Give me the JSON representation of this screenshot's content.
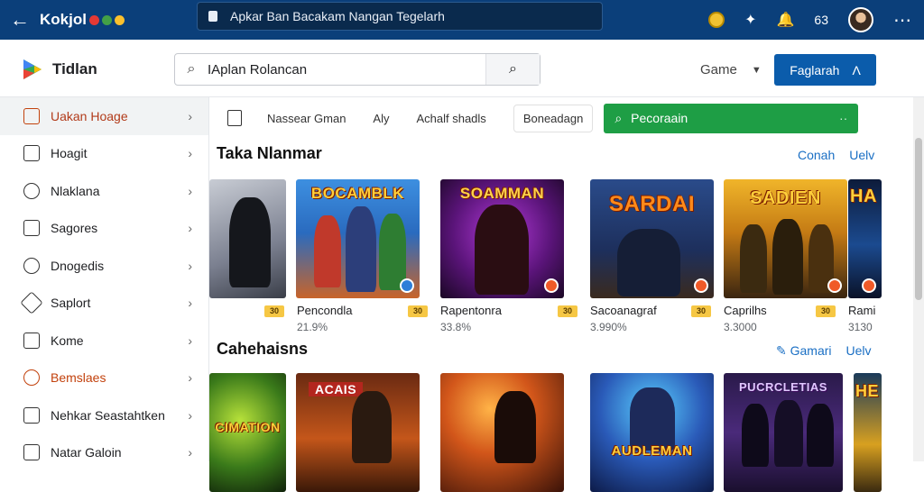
{
  "browser": {
    "brand": "Kokjol",
    "url": "Apkar Ban Bacakam Nangan Tegelarh",
    "notification_count": "63"
  },
  "app": {
    "title": "Tidlan",
    "search_value": "IAplan Rolancan",
    "game_select": "Game",
    "primary_button": "Faglarah"
  },
  "sidebar": {
    "items": [
      {
        "label": "Uakan Hoage"
      },
      {
        "label": "Hoagit"
      },
      {
        "label": "Nlaklana"
      },
      {
        "label": "Sagores"
      },
      {
        "label": "Dnogedis"
      },
      {
        "label": "Saplort"
      },
      {
        "label": "Kome"
      },
      {
        "label": "Bemslaes"
      },
      {
        "label": "Nehkar Seastahtken"
      },
      {
        "label": "Natar Galoin"
      }
    ]
  },
  "filters": {
    "item1": "Nassear Gman",
    "item2": "Aly",
    "item3": "Achalf shadls",
    "item4": "Boneadagn",
    "green_button": "Pecoraain"
  },
  "section1": {
    "title": "Taka Nlanmar",
    "link1": "Conah",
    "link2": "Uelv",
    "cards": [
      {
        "art": "",
        "name": "",
        "stat": "",
        "rating": ""
      },
      {
        "art": "BOCAMBLK",
        "name": "Pencondla",
        "stat": "21.9%",
        "rating": "30"
      },
      {
        "art": "SOAMMAN",
        "name": "Rapentonra",
        "stat": "33.8%",
        "rating": "30"
      },
      {
        "art": "SARDAI",
        "name": "Sacoanagraf",
        "stat": "3.990%",
        "rating": "30"
      },
      {
        "art": "SADIEN",
        "name": "Caprilhs",
        "stat": "3.3000",
        "rating": "30"
      },
      {
        "art": "HA",
        "name": "Rami",
        "stat": "3130",
        "rating": ""
      }
    ]
  },
  "section2": {
    "title": "Cahehaisns",
    "link1": "Gamari",
    "link2": "Uelv",
    "cards": [
      {
        "art": "CIMATION"
      },
      {
        "art": "ACAIS"
      },
      {
        "art": ""
      },
      {
        "art": "AUDLEMAN"
      },
      {
        "art": "PUCRCLETIAS"
      },
      {
        "art": "HE"
      }
    ]
  },
  "colors": {
    "topbar": "#0b3f7a",
    "primary": "#0b5cab",
    "green": "#1e9e45",
    "accent": "#c2410c",
    "link": "#1a6fc4"
  }
}
